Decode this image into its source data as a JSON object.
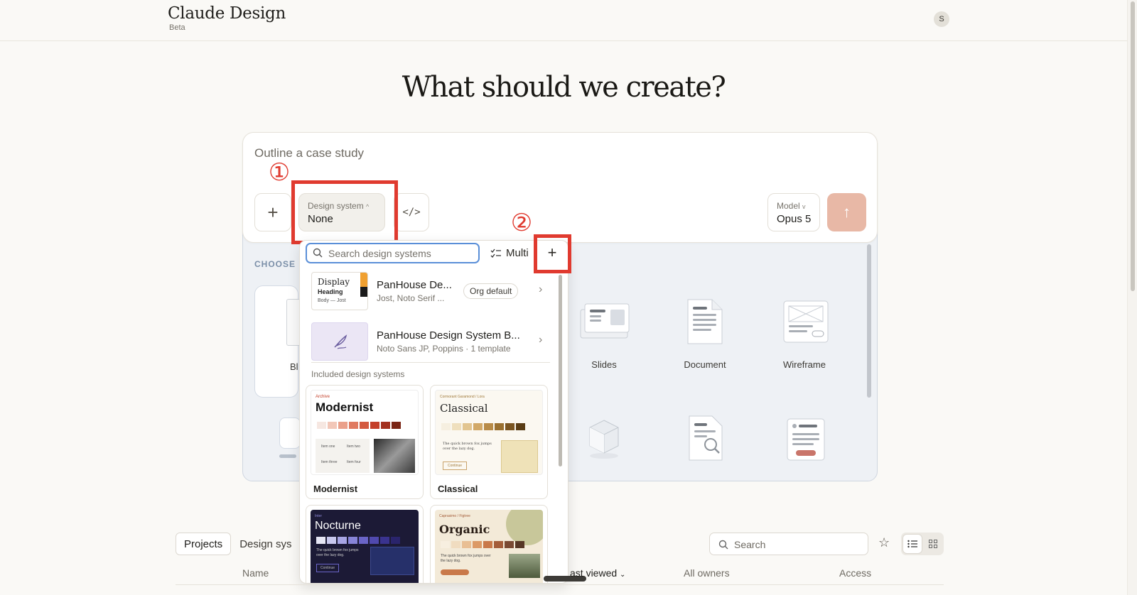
{
  "app": {
    "title": "Claude Design",
    "badge": "Beta",
    "avatar": "S"
  },
  "hero": {
    "title": "What should we create?"
  },
  "prompt": {
    "placeholder": "Outline a case study",
    "add_label": "+",
    "design_system": {
      "caption": "Design system",
      "value": "None"
    },
    "code_label": "</>",
    "model": {
      "caption": "Model",
      "value": "Opus 5"
    },
    "send_label": "↑"
  },
  "annotations": {
    "mark1": "①",
    "mark2": "②"
  },
  "categories": {
    "choose_label": "CHOOSE",
    "blank_label": "Bl",
    "items": [
      {
        "label": "Slides",
        "icon": "slides-icon"
      },
      {
        "label": "Document",
        "icon": "document-icon"
      },
      {
        "label": "Wireframe",
        "icon": "wireframe-icon"
      }
    ]
  },
  "dropdown": {
    "search_placeholder": "Search design systems",
    "multi_label": "Multi",
    "add_label": "+",
    "systems": [
      {
        "name": "PanHouse De...",
        "sub": "Jost, Noto Serif ...",
        "badge": "Org default",
        "thumb": {
          "line1": "Display",
          "line2": "Heading",
          "line3": "Body — Jost"
        }
      },
      {
        "name": "PanHouse Design System B...",
        "sub": "Noto Sans JP, Poppins · 1 template"
      }
    ],
    "section_label": "Included design systems",
    "cards": [
      {
        "name": "Modernist",
        "preview_tag": "Archive",
        "preview_title": "Modernist",
        "items": [
          "Item one",
          "Item two",
          "Item three",
          "Item four"
        ],
        "colors": [
          "#f6e7e1",
          "#f2c7b8",
          "#eaa08a",
          "#e07a60",
          "#d45a40",
          "#c4402a",
          "#a3301e",
          "#7a2414"
        ]
      },
      {
        "name": "Classical",
        "preview_tag": "Cormorant Garamond / Lora",
        "preview_title": "Classical",
        "body": "The quick brown fox jumps over the lazy dog.",
        "button": "Continue",
        "colors": [
          "#f6efe0",
          "#efdfbd",
          "#e2c590",
          "#d2a968",
          "#b88b47",
          "#9a7030",
          "#7a5522",
          "#5a3d16"
        ]
      },
      {
        "name": "Nocturne",
        "preview_tag": "Inter",
        "preview_title": "Nocturne",
        "body": "The quick brown fox jumps over the lazy dog.",
        "button": "Continue",
        "colors": [
          "#e6e6f5",
          "#c8c8ee",
          "#a7a5e4",
          "#8784d8",
          "#6a64c7",
          "#5049ae",
          "#3a338f",
          "#2a246c"
        ]
      },
      {
        "name": "Organic",
        "preview_tag": "Caprasimo / Figtree",
        "preview_title": "Organic",
        "body": "The quick brown fox jumps over the lazy dog.",
        "colors": [
          "#f7efe0",
          "#f0dcc0",
          "#e9bf94",
          "#dc9a66",
          "#c9794a",
          "#a45d3a",
          "#7a4a33",
          "#573726"
        ]
      }
    ]
  },
  "projects": {
    "tabs": [
      "Projects",
      "Design sys"
    ],
    "search_placeholder": "Search",
    "columns": {
      "name": "Name",
      "viewed": "ast viewed",
      "owners": "All owners",
      "access": "Access"
    }
  }
}
